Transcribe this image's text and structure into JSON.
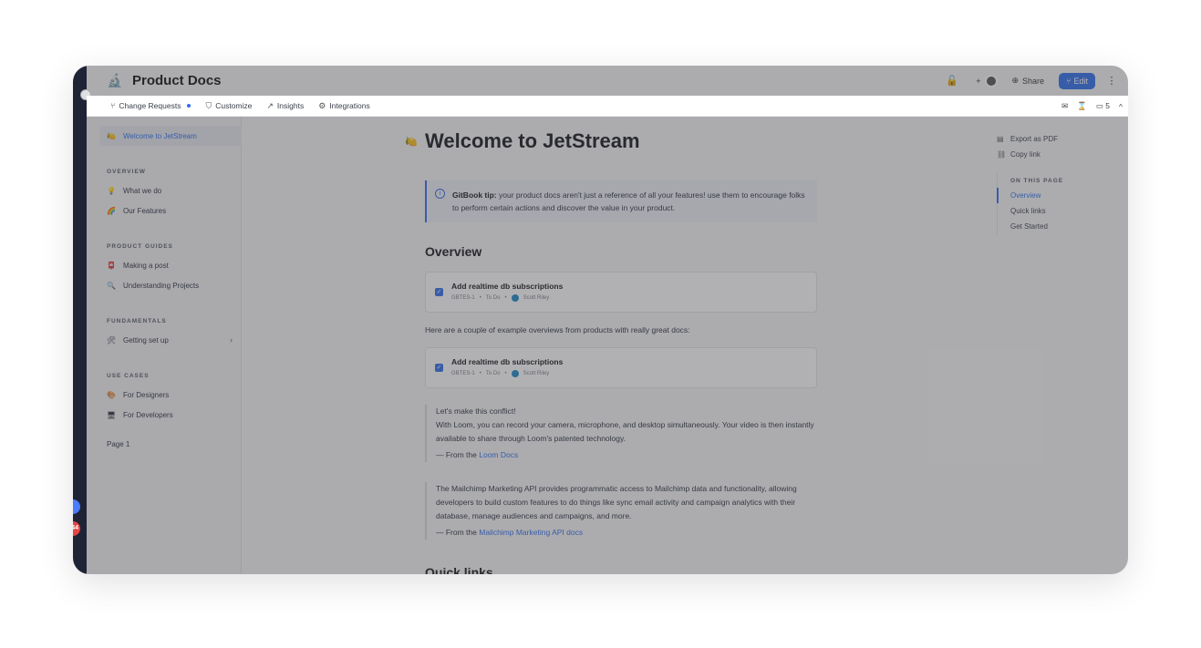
{
  "topbar": {
    "space_icon": "microscope-icon",
    "space_emoji": "🔬",
    "title": "Product Docs",
    "lock_icon": "🔓",
    "plus": "+",
    "share_label": "Share",
    "edit_label": "Edit"
  },
  "subbar": {
    "items": [
      {
        "icon": "⑂",
        "label": "Change Requests"
      },
      {
        "icon": "⛉",
        "label": "Customize"
      },
      {
        "icon": "↗",
        "label": "Insights"
      },
      {
        "icon": "⚙",
        "label": "Integrations"
      }
    ],
    "comment_count": "5"
  },
  "sidebar": {
    "welcome": {
      "emoji": "🍋",
      "label": "Welcome to JetStream"
    },
    "sections": [
      {
        "heading": "OVERVIEW",
        "items": [
          {
            "emoji": "💡",
            "label": "What we do"
          },
          {
            "emoji": "🌈",
            "label": "Our Features"
          }
        ]
      },
      {
        "heading": "PRODUCT GUIDES",
        "items": [
          {
            "emoji": "📮",
            "label": "Making a post"
          },
          {
            "emoji": "🔍",
            "label": "Understanding Projects"
          }
        ]
      },
      {
        "heading": "FUNDAMENTALS",
        "items": [
          {
            "emoji": "🛠",
            "label": "Getting set up"
          }
        ]
      },
      {
        "heading": "USE CASES",
        "items": [
          {
            "emoji": "🎨",
            "label": "For Designers"
          },
          {
            "emoji": "🖥",
            "label": "For Developers"
          }
        ]
      }
    ],
    "page1": "Page 1"
  },
  "main": {
    "emoji": "🍋",
    "title": "Welcome to JetStream",
    "hint_bold": "GitBook tip:",
    "hint_text": " your product docs aren't just a reference of all your features! use them to encourage folks to perform certain actions and discover the value in your product.",
    "overview_heading": "Overview",
    "issue": {
      "title": "Add realtime db subscriptions",
      "key": "GBTES-1",
      "status": "To Do",
      "assignee": "Scott Riley"
    },
    "para": "Here are a couple of example overviews from products with really great docs:",
    "quote1": {
      "line1": "Let's make this conflict!",
      "line2": "With Loom, you can record your camera, microphone, and desktop simultaneously. Your video is then instantly available to share through Loom's patented technology.",
      "src_prefix": "— From the ",
      "src_link": "Loom Docs"
    },
    "quote2": {
      "line1": "The Mailchimp Marketing API provides programmatic access to Mailchimp data and functionality, allowing developers to build custom features to do things like sync email activity and campaign analytics with their database, manage audiences and campaigns, and more.",
      "src_prefix": "— From the ",
      "src_link": "Mailchimp Marketing API docs"
    },
    "quick_links": "Quick links"
  },
  "rightcol": {
    "export_label": "Export as PDF",
    "copy_label": "Copy link",
    "toc_heading": "ON THIS PAGE",
    "toc": [
      "Overview",
      "Quick links",
      "Get Started"
    ]
  },
  "rail": {
    "badge_count": "44"
  }
}
